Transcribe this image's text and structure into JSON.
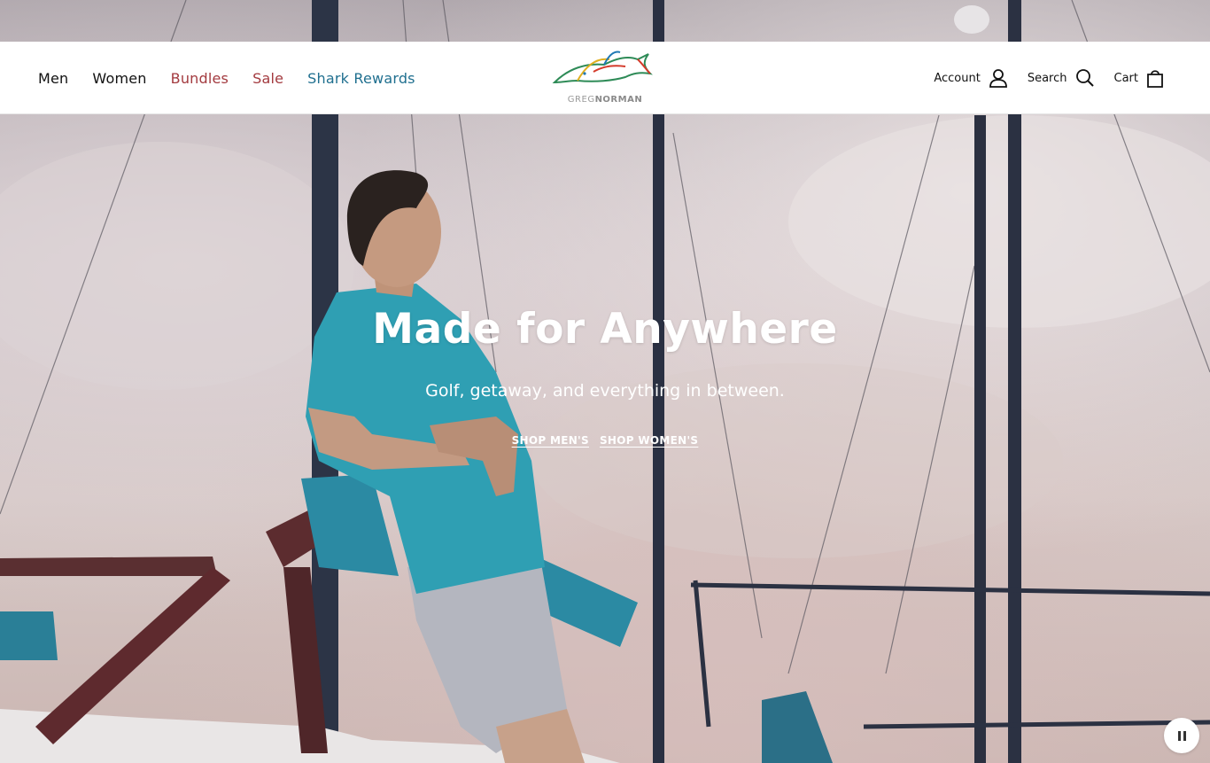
{
  "nav": {
    "men": "Men",
    "women": "Women",
    "bundles": "Bundles",
    "sale": "Sale",
    "shark_rewards": "Shark Rewards"
  },
  "logo": {
    "part1": "GREG",
    "part2": "NORMAN"
  },
  "utility": {
    "account": "Account",
    "search": "Search",
    "cart": "Cart"
  },
  "hero": {
    "title": "Made for Anywhere",
    "subtitle": "Golf, getaway, and everything in between.",
    "cta_men": "SHOP MEN'S",
    "cta_women": "SHOP WOMEN'S"
  },
  "colors": {
    "accent_red": "#a33a3f",
    "accent_teal": "#1f6f8f",
    "shirt_teal": "#2f9fb3"
  },
  "icons": {
    "account": "person-icon",
    "search": "magnifier-icon",
    "cart": "shopping-bag-icon",
    "pause": "pause-icon"
  }
}
